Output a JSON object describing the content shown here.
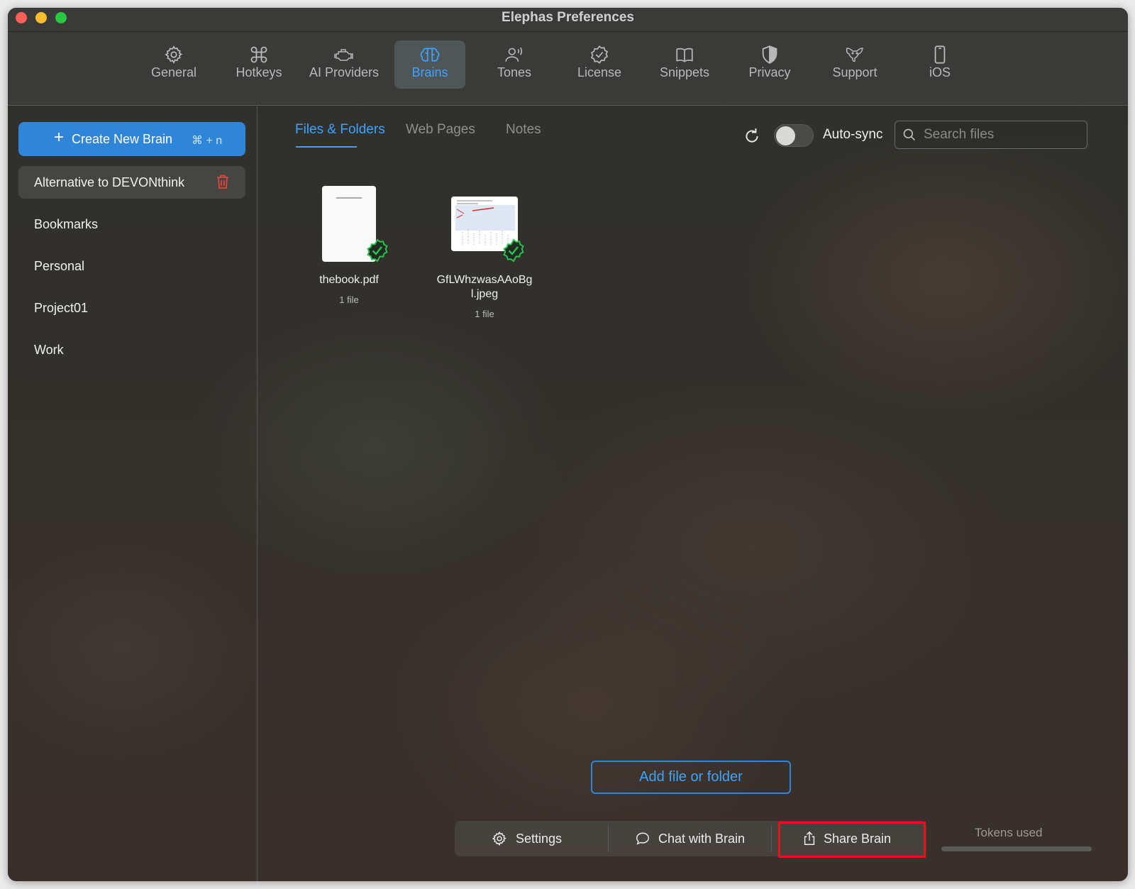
{
  "window": {
    "title": "Elephas Preferences"
  },
  "toolbar": {
    "items": [
      {
        "label": "General",
        "icon": "gear-icon"
      },
      {
        "label": "Hotkeys",
        "icon": "command-icon"
      },
      {
        "label": "AI Providers",
        "icon": "engine-icon"
      },
      {
        "label": "Brains",
        "icon": "brain-icon",
        "active": true
      },
      {
        "label": "Tones",
        "icon": "speaking-person-icon"
      },
      {
        "label": "License",
        "icon": "verified-badge-icon"
      },
      {
        "label": "Snippets",
        "icon": "book-icon"
      },
      {
        "label": "Privacy",
        "icon": "shield-icon"
      },
      {
        "label": "Support",
        "icon": "elephant-icon"
      },
      {
        "label": "iOS",
        "icon": "phone-icon"
      }
    ]
  },
  "sidebar": {
    "create_button": {
      "label": "Create New Brain",
      "shortcut": "⌘ + n"
    },
    "brains": [
      {
        "label": "Alternative to DEVONthink",
        "selected": true
      },
      {
        "label": "Bookmarks"
      },
      {
        "label": "Personal"
      },
      {
        "label": "Project01"
      },
      {
        "label": "Work"
      }
    ]
  },
  "main": {
    "tabs": [
      {
        "label": "Files & Folders",
        "active": true
      },
      {
        "label": "Web Pages"
      },
      {
        "label": "Notes"
      }
    ],
    "autosync": {
      "label": "Auto-sync",
      "enabled": false
    },
    "search": {
      "placeholder": "Search files",
      "value": ""
    },
    "files": [
      {
        "name": "thebook.pdf",
        "count": "1 file",
        "synced": true
      },
      {
        "name_line1": "GfLWhzwasAAoBg",
        "name_line2": "l.jpeg",
        "count": "1 file",
        "synced": true
      }
    ],
    "add_button": "Add file or folder",
    "actions": {
      "settings": "Settings",
      "chat": "Chat with Brain",
      "share": "Share Brain"
    },
    "tokens_label": "Tokens used"
  },
  "colors": {
    "accent": "#3ea3ff",
    "primary_button": "#2f86d8",
    "highlight_box": "#e3131c",
    "synced_badge": "#2fbf4f",
    "trash": "#e0443e"
  }
}
